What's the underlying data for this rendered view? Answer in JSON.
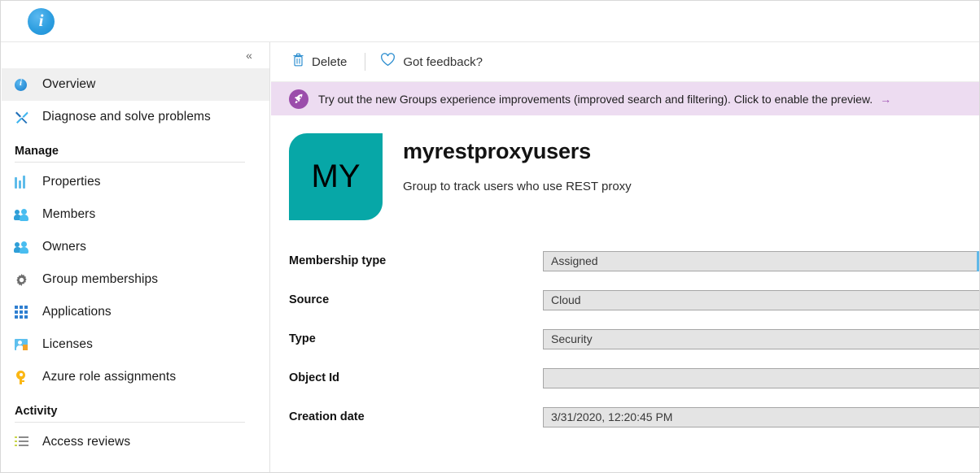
{
  "titlebar": {
    "icon": "info-icon"
  },
  "sidebar": {
    "collapse_label": "«",
    "items": [
      {
        "label": "Overview",
        "icon": "info-icon",
        "selected": true
      },
      {
        "label": "Diagnose and solve problems",
        "icon": "wrench-screwdriver-icon",
        "selected": false
      }
    ],
    "groups": [
      {
        "title": "Manage",
        "items": [
          {
            "label": "Properties",
            "icon": "sliders-icon"
          },
          {
            "label": "Members",
            "icon": "people-icon"
          },
          {
            "label": "Owners",
            "icon": "people-icon"
          },
          {
            "label": "Group memberships",
            "icon": "gear-icon"
          },
          {
            "label": "Applications",
            "icon": "grid-icon"
          },
          {
            "label": "Licenses",
            "icon": "license-card-icon"
          },
          {
            "label": "Azure role assignments",
            "icon": "key-icon"
          }
        ]
      },
      {
        "title": "Activity",
        "items": [
          {
            "label": "Access reviews",
            "icon": "checklist-icon"
          }
        ]
      }
    ]
  },
  "main": {
    "commands": [
      {
        "label": "Delete",
        "icon": "trash-icon"
      },
      {
        "label": "Got feedback?",
        "icon": "heart-icon"
      }
    ],
    "banner": {
      "icon": "rocket-icon",
      "text": "Try out the new Groups experience improvements (improved search and filtering). Click to enable the preview.",
      "arrow": "→",
      "background": "#eddcf1",
      "accent": "#9b4dab"
    },
    "group": {
      "avatar_initials": "MY",
      "avatar_color": "#07a7a7",
      "name": "myrestproxyusers",
      "description": "Group to track users who use REST proxy"
    },
    "properties": [
      {
        "label": "Membership type",
        "value": "Assigned",
        "focused": true
      },
      {
        "label": "Source",
        "value": "Cloud",
        "focused": false
      },
      {
        "label": "Type",
        "value": "Security",
        "focused": false
      },
      {
        "label": "Object Id",
        "value": "",
        "focused": false
      },
      {
        "label": "Creation date",
        "value": "3/31/2020, 12:20:45 PM",
        "focused": false
      }
    ]
  }
}
